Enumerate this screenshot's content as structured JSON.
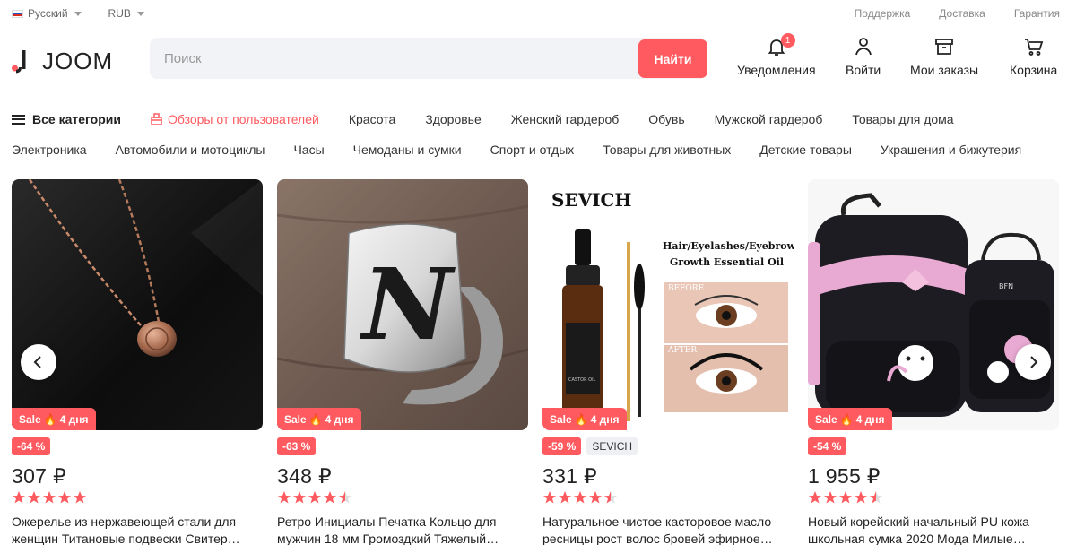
{
  "topbar": {
    "language": "Русский",
    "currency": "RUB",
    "links": [
      "Поддержка",
      "Доставка",
      "Гарантия"
    ]
  },
  "header": {
    "logo_text": "JOOM",
    "search": {
      "placeholder": "Поиск",
      "button": "Найти"
    },
    "nav": {
      "notifications": {
        "label": "Уведомления",
        "badge": "1"
      },
      "login": "Войти",
      "orders": "Мои заказы",
      "cart": "Корзина"
    }
  },
  "categories": {
    "all": "Все категории",
    "reviews": "Обзоры от пользователей",
    "row1": [
      "Красота",
      "Здоровье",
      "Женский гардероб",
      "Обувь",
      "Мужской гардероб",
      "Товары для дома"
    ],
    "row2": [
      "Электроника",
      "Автомобили и мотоциклы",
      "Часы",
      "Чемоданы и сумки",
      "Спорт и отдых",
      "Товары для животных",
      "Детские товары",
      "Украшения и бижутерия"
    ]
  },
  "products": [
    {
      "sale": "Sale",
      "days": "4 дня",
      "discount": "-64 %",
      "brand": "",
      "price": "307 ₽",
      "rating": 5,
      "title": "Ожерелье из нержавеющей стали для женщин Титановые подвески Свитер…"
    },
    {
      "sale": "Sale",
      "days": "4 дня",
      "discount": "-63 %",
      "brand": "",
      "price": "348 ₽",
      "rating": 4.5,
      "title": "Ретро Инициалы Печатка Кольцо для мужчин 18 мм Громоздкий Тяжелый…"
    },
    {
      "sale": "Sale",
      "days": "4 дня",
      "discount": "-59 %",
      "brand": "SEVICH",
      "price": "331 ₽",
      "rating": 4.5,
      "title": "Натуральное чистое касторовое масло ресницы рост волос бровей эфирное…",
      "image_text": {
        "logo": "SEVICH",
        "headline1": "Hair/Eyelashes/Eyebrow",
        "headline2": "Growth Essential Oil",
        "before": "BEFORE",
        "after": "AFTER",
        "bottle": "CASTOR OIL"
      }
    },
    {
      "sale": "Sale",
      "days": "4 дня",
      "discount": "-54 %",
      "brand": "",
      "price": "1 955 ₽",
      "rating": 4.5,
      "title": "Новый корейский начальный PU кожа школьная сумка 2020 Мода Милые…",
      "image_text": {
        "bag_brand": "BFN"
      }
    }
  ],
  "colors": {
    "accent": "#ff5a5f",
    "text": "#222222",
    "star": "#ff5a5f",
    "star_empty": "#dddddd"
  }
}
